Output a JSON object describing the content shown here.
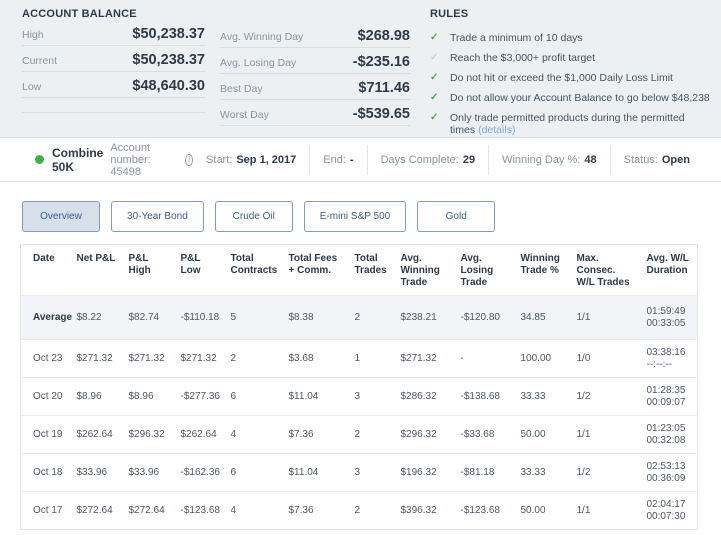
{
  "account_balance": {
    "title": "ACCOUNT BALANCE",
    "rows": [
      {
        "label": "High",
        "value": "$50,238.37"
      },
      {
        "label": "Current",
        "value": "$50,238.37"
      },
      {
        "label": "Low",
        "value": "$48,640.30"
      },
      {
        "label": "",
        "value": ""
      }
    ]
  },
  "day_stats": {
    "rows": [
      {
        "label": "Avg. Winning Day",
        "value": "$268.98"
      },
      {
        "label": "Avg. Losing Day",
        "value": "-$235.16"
      },
      {
        "label": "Best Day",
        "value": "$711.46"
      },
      {
        "label": "Worst Day",
        "value": "-$539.65"
      }
    ]
  },
  "rules": {
    "title": "RULES",
    "check_glyph": "✓",
    "items": [
      {
        "text": "Trade a minimum of 10 days",
        "pending": false
      },
      {
        "text": "Reach the $3,000+ profit target",
        "pending": true
      },
      {
        "text": "Do not hit or exceed the $1,000 Daily Loss Limit",
        "pending": false
      },
      {
        "text": "Do not allow your Account Balance to go below $48,238",
        "pending": false
      },
      {
        "text": "Only trade permitted products during the permitted times",
        "link": "(details)",
        "pending": false
      }
    ]
  },
  "account_info": {
    "name": "Combine 50K",
    "number_text": "Account number: 45498",
    "info_glyph": "i",
    "stats": [
      {
        "label": "Start:",
        "value": "Sep 1, 2017"
      },
      {
        "label": "End:",
        "value": "-"
      },
      {
        "label": "Days Complete:",
        "value": "29"
      },
      {
        "label": "Winning Day %:",
        "value": "48"
      },
      {
        "label": "Status:",
        "value": "Open"
      }
    ]
  },
  "tabs": [
    {
      "label": "Overview",
      "active": true
    },
    {
      "label": "30-Year Bond",
      "active": false
    },
    {
      "label": "Crude Oil",
      "active": false
    },
    {
      "label": "E-mini S&P 500",
      "active": false
    },
    {
      "label": "Gold",
      "active": false
    }
  ],
  "table": {
    "columns": [
      "Date",
      "Net P&L",
      "P&L High",
      "P&L Low",
      "Total Contracts",
      "Total Fees + Comm.",
      "Total Trades",
      "Avg. Winning Trade",
      "Avg. Losing Trade",
      "Winning Trade %",
      "Max. Consec. W/L Trades",
      "Avg. W/L Duration"
    ],
    "rows": [
      {
        "date": "Average",
        "average": true,
        "values": [
          "$8.22",
          "$82.74",
          "-$110.18",
          "5",
          "$8.38",
          "2",
          "$238.21",
          "-$120.80",
          "34.85",
          "1/1"
        ],
        "duration": [
          "01:59:49",
          "00:33:05"
        ]
      },
      {
        "date": "Oct 23",
        "average": false,
        "values": [
          "$271.32",
          "$271.32",
          "$271.32",
          "2",
          "$3.68",
          "1",
          "$271.32",
          "-",
          "100.00",
          "1/0"
        ],
        "duration": [
          "03:38:16",
          "--:--:--"
        ]
      },
      {
        "date": "Oct 20",
        "average": false,
        "values": [
          "$8.96",
          "$8.96",
          "-$277.36",
          "6",
          "$11.04",
          "3",
          "$286.32",
          "-$138.68",
          "33.33",
          "1/2"
        ],
        "duration": [
          "01:28:35",
          "00:09:07"
        ]
      },
      {
        "date": "Oct 19",
        "average": false,
        "values": [
          "$262.64",
          "$296.32",
          "$262.64",
          "4",
          "$7.36",
          "2",
          "$296.32",
          "-$33.68",
          "50.00",
          "1/1"
        ],
        "duration": [
          "01:23:05",
          "00:32:08"
        ]
      },
      {
        "date": "Oct 18",
        "average": false,
        "values": [
          "$33.96",
          "$33.96",
          "-$162.36",
          "6",
          "$11.04",
          "3",
          "$196.32",
          "-$81.18",
          "33.33",
          "1/2"
        ],
        "duration": [
          "02:53:13",
          "00:36:09"
        ]
      },
      {
        "date": "Oct 17",
        "average": false,
        "values": [
          "$272.64",
          "$272.64",
          "-$123.68",
          "4",
          "$7.36",
          "2",
          "$396.32",
          "-$123.68",
          "50.00",
          "1/1"
        ],
        "duration": [
          "02:04:17",
          "00:07:30"
        ]
      }
    ]
  },
  "colors": {
    "accent_green": "#3fae49",
    "pending_gray": "#c8d0d8",
    "link_blue": "#7fa8d9",
    "tab_blue": "#3f5d8f"
  }
}
